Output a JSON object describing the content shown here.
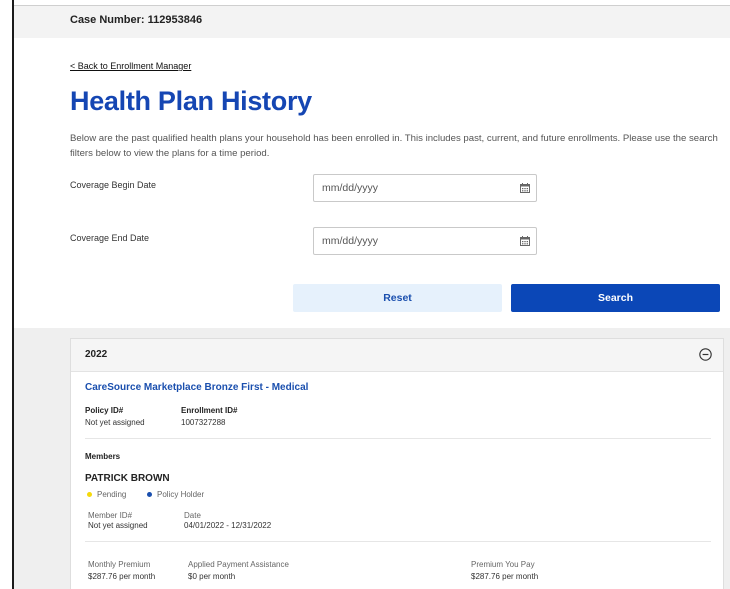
{
  "header": {
    "case_number": "Case Number: 112953846"
  },
  "nav": {
    "back_link": "< Back to Enrollment Manager"
  },
  "page": {
    "title": "Health Plan History",
    "description": "Below are the past qualified health plans your household has been enrolled in. This includes past, current, and future enrollments. Please use the search filters below to view the plans for a time period."
  },
  "filters": {
    "begin_label": "Coverage Begin Date",
    "begin_placeholder": "mm/dd/yyyy",
    "end_label": "Coverage End Date",
    "end_placeholder": "mm/dd/yyyy",
    "reset_label": "Reset",
    "search_label": "Search"
  },
  "plan_card": {
    "year": "2022",
    "plan_name": "CareSource Marketplace Bronze First - Medical",
    "policy_id_label": "Policy ID#",
    "policy_id_value": "Not yet assigned",
    "enrollment_id_label": "Enrollment ID#",
    "enrollment_id_value": "1007327288",
    "members_label": "Members",
    "member": {
      "name": "PATRICK BROWN",
      "status_pending": "Pending",
      "status_role": "Policy Holder",
      "member_id_label": "Member ID#",
      "member_id_value": "Not yet assigned",
      "date_label": "Date",
      "date_value": "04/01/2022 - 12/31/2022"
    },
    "monthly_premium_label": "Monthly Premium",
    "monthly_premium_value": "$287.76 per month",
    "assistance_label": "Applied Payment Assistance",
    "assistance_value": "$0 per month",
    "you_pay_label": "Premium You Pay",
    "you_pay_value": "$287.76 per month"
  },
  "colors": {
    "brand_blue": "#1546b3",
    "search_button": "#0b47b7",
    "reset_button": "#e6f1fc",
    "pending_dot": "#f5d90a",
    "policy_holder_dot": "#1a4fae"
  },
  "icons": {
    "date_picker": "calendar-icon",
    "collapse": "minus-circle-icon"
  }
}
